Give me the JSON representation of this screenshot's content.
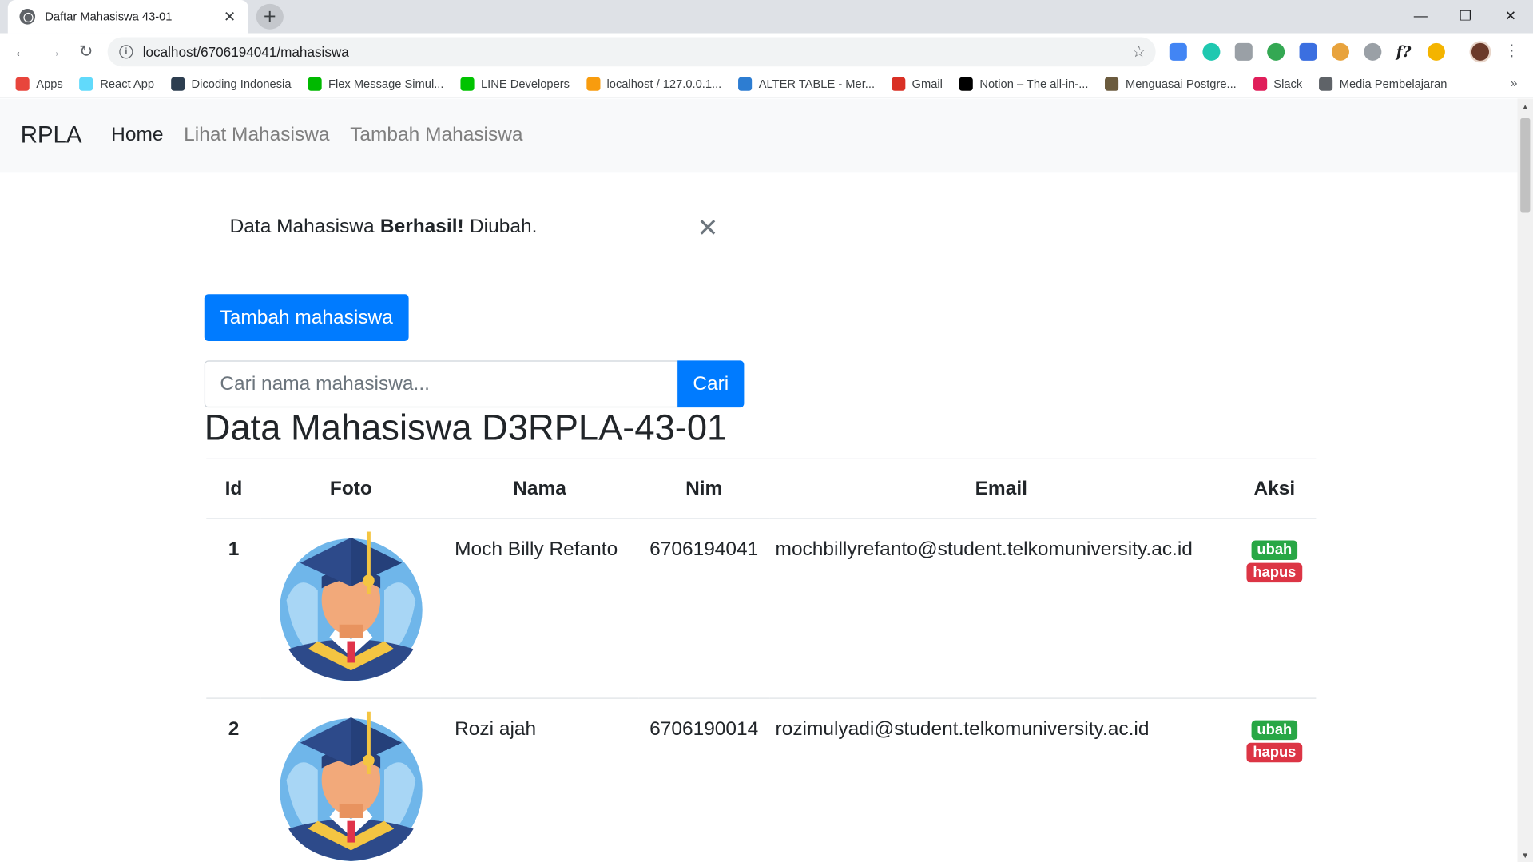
{
  "browser": {
    "tab_title": "Daftar Mahasiswa 43-01",
    "url": "localhost/6706194041/mahasiswa",
    "bookmarks": [
      {
        "label": "Apps",
        "color": "#e8453c"
      },
      {
        "label": "React App",
        "color": "#61dafb"
      },
      {
        "label": "Dicoding Indonesia",
        "color": "#2d3e50"
      },
      {
        "label": "Flex Message Simul...",
        "color": "#00b900"
      },
      {
        "label": "LINE Developers",
        "color": "#00c300"
      },
      {
        "label": "localhost / 127.0.0.1...",
        "color": "#f89c0e"
      },
      {
        "label": "ALTER TABLE - Mer...",
        "color": "#2d7dd2"
      },
      {
        "label": "Gmail",
        "color": "#d93025"
      },
      {
        "label": "Notion – The all-in-...",
        "color": "#000000"
      },
      {
        "label": "Menguasai Postgre...",
        "color": "#6b5b3e"
      },
      {
        "label": "Slack",
        "color": "#e01e5a"
      },
      {
        "label": "Media Pembelajaran",
        "color": "#5f6368"
      }
    ]
  },
  "navbar": {
    "brand": "RPLA",
    "links": [
      "Home",
      "Lihat Mahasiswa",
      "Tambah Mahasiswa"
    ]
  },
  "alert": {
    "prefix": "Data Mahasiswa",
    "strong": "Berhasil!",
    "suffix": "Diubah."
  },
  "add_button": "Tambah mahasiswa",
  "search": {
    "placeholder": "Cari nama mahasiswa...",
    "button": "Cari"
  },
  "heading": "Data Mahasiswa D3RPLA-43-01",
  "table": {
    "headers": [
      "Id",
      "Foto",
      "Nama",
      "Nim",
      "Email",
      "Aksi"
    ],
    "rows": [
      {
        "id": "1",
        "nama": "Moch Billy Refanto",
        "nim": "6706194041",
        "email": "mochbillyrefanto@student.telkomuniversity.ac.id",
        "ubah": "ubah",
        "hapus": "hapus"
      },
      {
        "id": "2",
        "nama": "Rozi ajah",
        "nim": "6706190014",
        "email": "rozimulyadi@student.telkomuniversity.ac.id",
        "ubah": "ubah",
        "hapus": "hapus"
      }
    ]
  },
  "colors": {
    "primary": "#007bff",
    "success": "#28a745",
    "danger": "#dc3545"
  }
}
